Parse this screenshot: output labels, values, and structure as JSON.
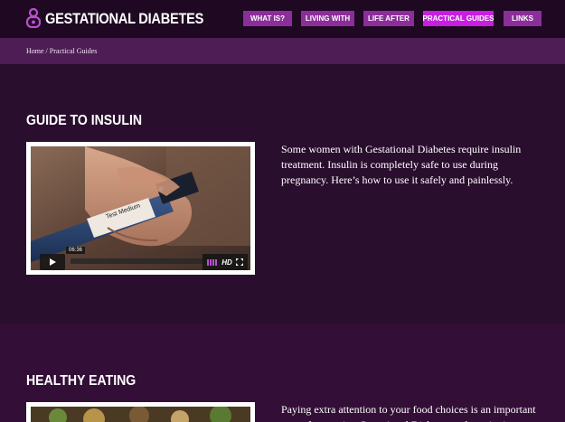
{
  "header": {
    "site_title": "GESTATIONAL DIABETES",
    "nav": [
      {
        "label": "WHAT IS?",
        "active": false
      },
      {
        "label": "LIVING WITH",
        "active": false
      },
      {
        "label": "LIFE AFTER",
        "active": false
      },
      {
        "label": "PRACTICAL GUIDES",
        "active": true
      },
      {
        "label": "LINKS",
        "active": false
      }
    ]
  },
  "breadcrumb": "Home / Practical Guides",
  "sections": [
    {
      "heading": "GUIDE TO INSULIN",
      "text": "Some women with Gestational Diabetes require insulin treatment. Insulin is completely safe to use during pregnancy. Here’s how to use it safely and painlessly.",
      "video": {
        "time": "06:36",
        "hd_label": "HD",
        "pen_label": "Test Medium",
        "progress": 0
      }
    },
    {
      "heading": "HEALTHY EATING",
      "text": "Paying extra attention to your food choices is an important way of managing Gestational Diabetes and continuing on"
    }
  ],
  "colors": {
    "header_bg": "#1e0822",
    "nav_button": "#8c2e9a",
    "nav_active": "#c81ee0",
    "crumb_bar": "#4e1d55",
    "page_bg": "#2a0e2e",
    "logo": "#b94fcf"
  }
}
